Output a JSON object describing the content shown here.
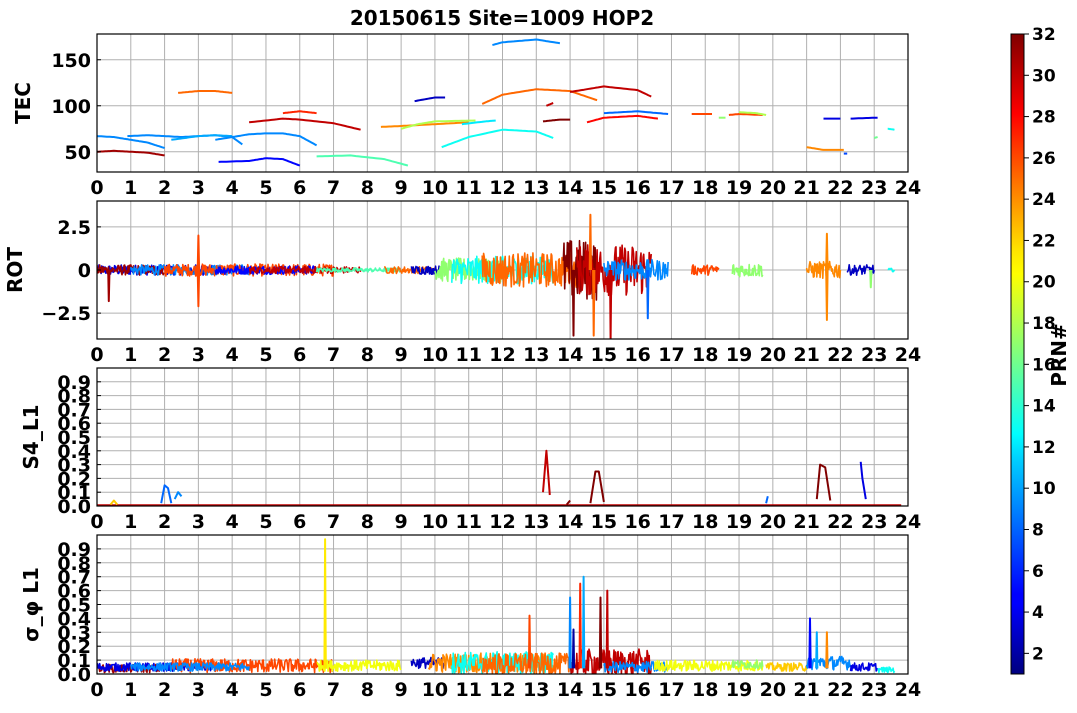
{
  "title": "20150615 Site=1009 HOP2",
  "colorbar": {
    "label": "PRN#",
    "min": 1,
    "max": 32,
    "ticks": [
      2,
      4,
      6,
      8,
      10,
      12,
      14,
      16,
      18,
      20,
      22,
      24,
      26,
      28,
      30,
      32
    ],
    "colormap": "jet"
  },
  "chart_data": [
    {
      "type": "line",
      "ylabel": "TEC",
      "xlim": [
        0,
        24
      ],
      "ylim": [
        28,
        178
      ],
      "yticks": [
        50,
        100,
        150
      ],
      "xticks": [
        0,
        1,
        2,
        3,
        4,
        5,
        6,
        7,
        8,
        9,
        10,
        11,
        12,
        13,
        14,
        15,
        16,
        17,
        18,
        19,
        20,
        21,
        22,
        23,
        24
      ],
      "grid": true,
      "series": [
        {
          "prn": 31,
          "x": [
            0,
            0.5,
            1,
            1.5,
            2
          ],
          "y": [
            50,
            51,
            50,
            49,
            46
          ]
        },
        {
          "prn": 9,
          "x": [
            0,
            0.5,
            1,
            1.5,
            2
          ],
          "y": [
            67,
            66,
            63,
            60,
            54
          ]
        },
        {
          "prn": 9,
          "x": [
            0.9,
            1.5,
            2,
            2.5,
            3,
            3.5,
            4,
            4.3
          ],
          "y": [
            67,
            68,
            67,
            66,
            67,
            68,
            66,
            58
          ]
        },
        {
          "prn": 10,
          "x": [
            2.2,
            3,
            3.5,
            4
          ],
          "y": [
            63,
            67,
            68,
            67
          ]
        },
        {
          "prn": 25,
          "x": [
            2.4,
            3,
            3.5,
            4
          ],
          "y": [
            114,
            116,
            116,
            114
          ]
        },
        {
          "prn": 5,
          "x": [
            3.6,
            4.5,
            5,
            5.5,
            6
          ],
          "y": [
            39,
            40,
            43,
            42,
            35
          ]
        },
        {
          "prn": 9,
          "x": [
            3.5,
            4.5,
            5,
            5.5,
            6,
            6.5
          ],
          "y": [
            63,
            69,
            70,
            70,
            67,
            57
          ]
        },
        {
          "prn": 30,
          "x": [
            4.5,
            5.5,
            6,
            7,
            7.8
          ],
          "y": [
            82,
            86,
            85,
            81,
            74
          ]
        },
        {
          "prn": 27,
          "x": [
            5.5,
            6,
            6.5
          ],
          "y": [
            92,
            94,
            92
          ]
        },
        {
          "prn": 15,
          "x": [
            6.5,
            7.5,
            8.5,
            9.2
          ],
          "y": [
            45,
            46,
            42,
            35
          ]
        },
        {
          "prn": 24,
          "x": [
            8.4,
            9,
            10,
            11
          ],
          "y": [
            77,
            78,
            80,
            82
          ]
        },
        {
          "prn": 18,
          "x": [
            9,
            9.5,
            10,
            11.2
          ],
          "y": [
            75,
            80,
            83,
            84
          ]
        },
        {
          "prn": 3,
          "x": [
            9.4,
            10,
            10.3
          ],
          "y": [
            105,
            109,
            109
          ]
        },
        {
          "prn": 13,
          "x": [
            10.2,
            11,
            12,
            13,
            13.5
          ],
          "y": [
            55,
            66,
            74,
            72,
            65
          ]
        },
        {
          "prn": 12,
          "x": [
            10.8,
            11.5,
            11.8
          ],
          "y": [
            80,
            83,
            84
          ]
        },
        {
          "prn": 9,
          "x": [
            11.7,
            12,
            13,
            13.7
          ],
          "y": [
            166,
            169,
            172,
            168
          ]
        },
        {
          "prn": 25,
          "x": [
            11.4,
            12,
            13,
            14,
            14.8
          ],
          "y": [
            102,
            112,
            118,
            116,
            106
          ]
        },
        {
          "prn": 30,
          "x": [
            13.3,
            13.5
          ],
          "y": [
            100,
            103
          ]
        },
        {
          "prn": 32,
          "x": [
            13.2,
            13.7,
            14
          ],
          "y": [
            83,
            85,
            85
          ]
        },
        {
          "prn": 30,
          "x": [
            14,
            15,
            16,
            16.4
          ],
          "y": [
            115,
            121,
            117,
            110
          ]
        },
        {
          "prn": 28,
          "x": [
            14.5,
            15,
            16,
            16.6
          ],
          "y": [
            82,
            87,
            89,
            86
          ]
        },
        {
          "prn": 8,
          "x": [
            15,
            16,
            16.9
          ],
          "y": [
            92,
            94,
            91
          ]
        },
        {
          "prn": 26,
          "x": [
            17.6,
            18.2
          ],
          "y": [
            91,
            91
          ]
        },
        {
          "prn": 17,
          "x": [
            18.4,
            18.6
          ],
          "y": [
            87,
            87
          ]
        },
        {
          "prn": 26,
          "x": [
            18.7,
            19,
            19.7
          ],
          "y": [
            90,
            91,
            90
          ]
        },
        {
          "prn": 18,
          "x": [
            19,
            19.5,
            19.8
          ],
          "y": [
            93,
            92,
            90
          ]
        },
        {
          "prn": 24,
          "x": [
            21,
            21.5,
            22.1
          ],
          "y": [
            55,
            52,
            52
          ]
        },
        {
          "prn": 4,
          "x": [
            21.5,
            22
          ],
          "y": [
            86,
            86
          ]
        },
        {
          "prn": 7,
          "x": [
            22.1,
            22.2
          ],
          "y": [
            48,
            48
          ]
        },
        {
          "prn": 4,
          "x": [
            22.3,
            23,
            23.1
          ],
          "y": [
            86,
            87,
            87
          ]
        },
        {
          "prn": 16,
          "x": [
            23,
            23.1
          ],
          "y": [
            65,
            66
          ]
        },
        {
          "prn": 13,
          "x": [
            23.4,
            23.6
          ],
          "y": [
            75,
            74
          ]
        }
      ]
    },
    {
      "type": "line",
      "ylabel": "ROT",
      "xlim": [
        0,
        24
      ],
      "ylim": [
        -4,
        4
      ],
      "yticks": [
        -2.5,
        0.0,
        2.5
      ],
      "xticks": [
        0,
        1,
        2,
        3,
        4,
        5,
        6,
        7,
        8,
        9,
        10,
        11,
        12,
        13,
        14,
        15,
        16,
        17,
        18,
        19,
        20,
        21,
        22,
        23,
        24
      ],
      "grid": true,
      "noise_segments": [
        {
          "prn": 4,
          "start": 0,
          "end": 3.5,
          "amp": 0.3
        },
        {
          "prn": 31,
          "start": 0,
          "end": 2,
          "amp": 0.3
        },
        {
          "prn": 9,
          "start": 1,
          "end": 4.5,
          "amp": 0.3
        },
        {
          "prn": 26,
          "start": 2,
          "end": 7,
          "amp": 0.35
        },
        {
          "prn": 5,
          "start": 3.5,
          "end": 6.5,
          "amp": 0.25
        },
        {
          "prn": 30,
          "start": 4.5,
          "end": 7.8,
          "amp": 0.2
        },
        {
          "prn": 15,
          "start": 6.5,
          "end": 9,
          "amp": 0.12
        },
        {
          "prn": 25,
          "start": 8.5,
          "end": 10,
          "amp": 0.2
        },
        {
          "prn": 3,
          "start": 9.3,
          "end": 10.3,
          "amp": 0.25
        },
        {
          "prn": 17,
          "start": 10,
          "end": 12,
          "amp": 0.7
        },
        {
          "prn": 13,
          "start": 10.5,
          "end": 13.5,
          "amp": 0.8
        },
        {
          "prn": 25,
          "start": 11.4,
          "end": 14.5,
          "amp": 1.0
        },
        {
          "prn": 32,
          "start": 13.8,
          "end": 14.8,
          "amp": 1.8
        },
        {
          "prn": 30,
          "start": 14.2,
          "end": 16.4,
          "amp": 1.5
        },
        {
          "prn": 9,
          "start": 15,
          "end": 16.9,
          "amp": 0.6
        },
        {
          "prn": 26,
          "start": 17.6,
          "end": 18.4,
          "amp": 0.3
        },
        {
          "prn": 17,
          "start": 18.8,
          "end": 19.7,
          "amp": 0.4
        },
        {
          "prn": 24,
          "start": 21,
          "end": 22,
          "amp": 0.5
        },
        {
          "prn": 3,
          "start": 22.2,
          "end": 23,
          "amp": 0.3
        },
        {
          "prn": 13,
          "start": 23.4,
          "end": 23.6,
          "amp": 0.1
        }
      ],
      "spikes": [
        {
          "prn": 31,
          "x": 0.35,
          "y": -1.8
        },
        {
          "prn": 26,
          "x": 3.0,
          "y": 2.0
        },
        {
          "prn": 26,
          "x": 3.0,
          "y": -2.1
        },
        {
          "prn": 25,
          "x": 14.6,
          "y": 3.2
        },
        {
          "prn": 32,
          "x": 14.1,
          "y": -3.8
        },
        {
          "prn": 30,
          "x": 15.2,
          "y": -4.0
        },
        {
          "prn": 25,
          "x": 14.7,
          "y": -3.8
        },
        {
          "prn": 8,
          "x": 16.3,
          "y": -2.8
        },
        {
          "prn": 24,
          "x": 21.6,
          "y": 2.1
        },
        {
          "prn": 24,
          "x": 21.6,
          "y": -2.9
        },
        {
          "prn": 17,
          "x": 22.9,
          "y": -1.0
        }
      ]
    },
    {
      "type": "line",
      "ylabel": "S4_L1",
      "xlim": [
        0,
        24
      ],
      "ylim": [
        0,
        1.0
      ],
      "yticks": [
        0.0,
        0.1,
        0.2,
        0.3,
        0.4,
        0.5,
        0.6,
        0.7,
        0.8,
        0.9
      ],
      "xticks": [
        0,
        1,
        2,
        3,
        4,
        5,
        6,
        7,
        8,
        9,
        10,
        11,
        12,
        13,
        14,
        15,
        16,
        17,
        18,
        19,
        20,
        21,
        22,
        23,
        24
      ],
      "grid": true,
      "baseline": {
        "prn": 30,
        "start": 0,
        "end": 23.8,
        "y": 0.005
      },
      "events": [
        {
          "prn": 22,
          "x": [
            0.4,
            0.5,
            0.6
          ],
          "y": [
            0.01,
            0.04,
            0.01
          ]
        },
        {
          "prn": 8,
          "x": [
            1.9,
            2.0,
            2.1,
            2.2
          ],
          "y": [
            0.02,
            0.15,
            0.13,
            0.02
          ]
        },
        {
          "prn": 9,
          "x": [
            2.3,
            2.4,
            2.5
          ],
          "y": [
            0.05,
            0.1,
            0.07
          ]
        },
        {
          "prn": 30,
          "x": [
            13.2,
            13.3,
            13.4
          ],
          "y": [
            0.1,
            0.4,
            0.08
          ]
        },
        {
          "prn": 32,
          "x": [
            13.9,
            14.0
          ],
          "y": [
            0.01,
            0.04
          ]
        },
        {
          "prn": 32,
          "x": [
            14.6,
            14.75,
            14.85,
            15.0
          ],
          "y": [
            0.02,
            0.25,
            0.25,
            0.03
          ]
        },
        {
          "prn": 8,
          "x": [
            19.8,
            19.85
          ],
          "y": [
            0.02,
            0.07
          ]
        },
        {
          "prn": 32,
          "x": [
            21.3,
            21.4,
            21.55,
            21.7
          ],
          "y": [
            0.05,
            0.3,
            0.28,
            0.04
          ]
        },
        {
          "prn": 4,
          "x": [
            22.6,
            22.65,
            22.75
          ],
          "y": [
            0.32,
            0.2,
            0.05
          ]
        }
      ]
    },
    {
      "type": "line",
      "ylabel": "σ_φ L1",
      "xlim": [
        0,
        24
      ],
      "ylim": [
        0,
        1.0
      ],
      "yticks": [
        0.0,
        0.1,
        0.2,
        0.3,
        0.4,
        0.5,
        0.6,
        0.7,
        0.8,
        0.9
      ],
      "xticks": [
        0,
        1,
        2,
        3,
        4,
        5,
        6,
        7,
        8,
        9,
        10,
        11,
        12,
        13,
        14,
        15,
        16,
        17,
        18,
        19,
        20,
        21,
        22,
        23,
        24
      ],
      "grid": true,
      "noise_segments": [
        {
          "prn": 31,
          "start": 0,
          "end": 2,
          "amp": 0.03,
          "base": 0.04
        },
        {
          "prn": 4,
          "start": 0,
          "end": 3.5,
          "amp": 0.03,
          "base": 0.05
        },
        {
          "prn": 26,
          "start": 2.2,
          "end": 7,
          "amp": 0.05,
          "base": 0.06
        },
        {
          "prn": 9,
          "start": 1,
          "end": 4.5,
          "amp": 0.03,
          "base": 0.05
        },
        {
          "prn": 20,
          "start": 6.5,
          "end": 9,
          "amp": 0.04,
          "base": 0.06
        },
        {
          "prn": 3,
          "start": 9.3,
          "end": 10.3,
          "amp": 0.04,
          "base": 0.08
        },
        {
          "prn": 24,
          "start": 9.8,
          "end": 13.5,
          "amp": 0.07,
          "base": 0.08
        },
        {
          "prn": 13,
          "start": 10.5,
          "end": 13.5,
          "amp": 0.08,
          "base": 0.08
        },
        {
          "prn": 25,
          "start": 11.4,
          "end": 14,
          "amp": 0.08,
          "base": 0.07
        },
        {
          "prn": 30,
          "start": 14,
          "end": 16.4,
          "amp": 0.1,
          "base": 0.08
        },
        {
          "prn": 9,
          "start": 15,
          "end": 16.9,
          "amp": 0.04,
          "base": 0.05
        },
        {
          "prn": 20,
          "start": 16.5,
          "end": 19.7,
          "amp": 0.04,
          "base": 0.06
        },
        {
          "prn": 17,
          "start": 18.8,
          "end": 19.7,
          "amp": 0.03,
          "base": 0.07
        },
        {
          "prn": 22,
          "start": 19.8,
          "end": 21,
          "amp": 0.03,
          "base": 0.05
        },
        {
          "prn": 9,
          "start": 21,
          "end": 22.3,
          "amp": 0.05,
          "base": 0.08
        },
        {
          "prn": 4,
          "start": 22.3,
          "end": 23.1,
          "amp": 0.03,
          "base": 0.05
        },
        {
          "prn": 13,
          "start": 23.1,
          "end": 23.6,
          "amp": 0.02,
          "base": 0.03
        }
      ],
      "spikes": [
        {
          "prn": 21,
          "x": 6.75,
          "y": 0.97
        },
        {
          "prn": 26,
          "x": 12.8,
          "y": 0.42
        },
        {
          "prn": 9,
          "x": 14.0,
          "y": 0.55
        },
        {
          "prn": 10,
          "x": 14.4,
          "y": 0.7
        },
        {
          "prn": 27,
          "x": 14.3,
          "y": 0.65
        },
        {
          "prn": 32,
          "x": 14.9,
          "y": 0.55
        },
        {
          "prn": 30,
          "x": 15.1,
          "y": 0.6
        },
        {
          "prn": 2,
          "x": 14.1,
          "y": 0.32
        },
        {
          "prn": 5,
          "x": 21.1,
          "y": 0.4
        },
        {
          "prn": 10,
          "x": 21.3,
          "y": 0.3
        },
        {
          "prn": 24,
          "x": 21.6,
          "y": 0.3
        }
      ]
    }
  ]
}
